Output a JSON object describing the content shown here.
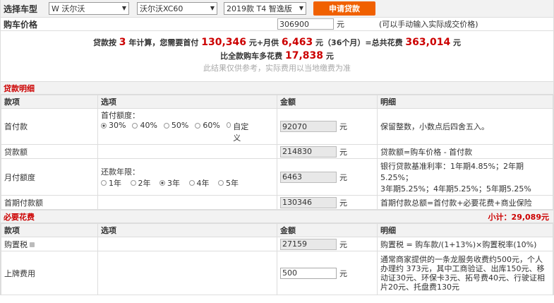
{
  "selector": {
    "label": "选择车型",
    "brand": "W 沃尔沃",
    "model": "沃尔沃XC60",
    "trim": "2019款 T4 智逸版",
    "apply_button": "申请贷款"
  },
  "price": {
    "label": "购车价格",
    "value": "306900",
    "unit": "元",
    "hint": "(可以手动输入实际成交价格)"
  },
  "summary": {
    "p1": "贷款按",
    "years": "3",
    "p2": "年计算，您需要首付",
    "down": "130,346",
    "p3": "元+月供",
    "monthly": "6,463",
    "p4": "元（36个月）=总共花费",
    "total": "363,014",
    "p5": "元",
    "p6": "比全款购车多花费",
    "extra": "17,838",
    "p7": "元",
    "note": "此结果仅供参考，实际费用以当地缴费为准"
  },
  "loan": {
    "title": "贷款明细",
    "headers": [
      "款项",
      "选项",
      "金额",
      "明细"
    ],
    "down_payment": {
      "name": "首付款",
      "option_label": "首付额度：",
      "options": [
        "30%",
        "40%",
        "50%",
        "60%",
        "自定义"
      ],
      "amount": "92070",
      "unit": "元",
      "detail": "保留整数，小数点后四舍五入。"
    },
    "loan_amount": {
      "name": "贷款额",
      "amount": "214830",
      "unit": "元",
      "detail": "贷款额=购车价格 - 首付款"
    },
    "monthly": {
      "name": "月付额度",
      "option_label": "还款年限：",
      "options": [
        "1年",
        "2年",
        "3年",
        "4年",
        "5年"
      ],
      "amount": "6463",
      "unit": "元",
      "detail_1": "银行贷款基准利率：1年期4.85%；2年期5.25%；",
      "detail_2": "3年期5.25%；4年期5.25%；5年期5.25%"
    },
    "first_payment": {
      "name": "首期付款额",
      "amount": "130346",
      "unit": "元",
      "detail": "首期付款总额=首付款+必要花费+商业保险"
    }
  },
  "required": {
    "title": "必要花费",
    "subtotal": "小计：29,089元",
    "headers": [
      "款项",
      "选项",
      "金额",
      "明细"
    ],
    "tax": {
      "name": "购置税",
      "amount": "27159",
      "unit": "元",
      "detail": "购置税 = 购车款/(1+13%)×购置税率(10%)"
    },
    "plate": {
      "name": "上牌费用",
      "amount": "500",
      "unit": "元",
      "detail": "通常商家提供的一条龙服务收费约500元，个人办理约 373元，其中工商验证、出库150元、移动证30元、环保卡3元、拓号费40元、行驶证相片20元、托盘费130元"
    }
  }
}
